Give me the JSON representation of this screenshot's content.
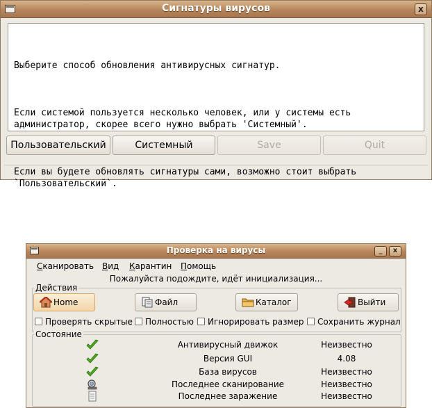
{
  "dialog": {
    "title": "Сигнатуры вирусов",
    "message": [
      "Выберите способ обновления антивирусных сигнатур.",
      "Если системой пользуется несколько человек, или у системы есть\nадминистратор, скорее всего нужно выбрать 'Системный'.",
      "Если вы будете обновлять сигнатуры сами, возможно стоит выбрать\n`Пользовательский`."
    ],
    "buttons": {
      "user": "Пользовательский",
      "system": "Системный",
      "save": "Save",
      "quit": "Quit"
    },
    "close_label": "x"
  },
  "scanner": {
    "title": "Проверка на вирусы",
    "minimize_label": "_",
    "close_label": "x",
    "menu": [
      "Сканировать",
      "Вид",
      "Карантин",
      "Помощь"
    ],
    "status_message": "Пожалуйста подождите, идёт инициализация...",
    "actions_label": "Действия",
    "actions": {
      "home": "Home",
      "file": "Файл",
      "catalog": "Каталог",
      "exit": "Выйти"
    },
    "options": [
      "Проверять скрытые",
      "Полностью",
      "Игнорировать размер",
      "Сохранить журнал"
    ],
    "state_label": "Состояние",
    "state_rows": [
      {
        "name": "Антивирусный движок",
        "value": "Неизвестно",
        "icon": "check-icon"
      },
      {
        "name": "Версия GUI",
        "value": "4.08",
        "icon": "check-icon"
      },
      {
        "name": "База вирусов",
        "value": "Неизвестно",
        "icon": "check-icon"
      },
      {
        "name": "Последнее сканирование",
        "value": "Неизвестно",
        "icon": "scan-icon"
      },
      {
        "name": "Последнее заражение",
        "value": "Неизвестно",
        "icon": "document-icon"
      }
    ]
  },
  "colors": {
    "titlebar": "#b8865c",
    "window_bg": "#ede9e3",
    "check_green": "#3f9a1e"
  }
}
